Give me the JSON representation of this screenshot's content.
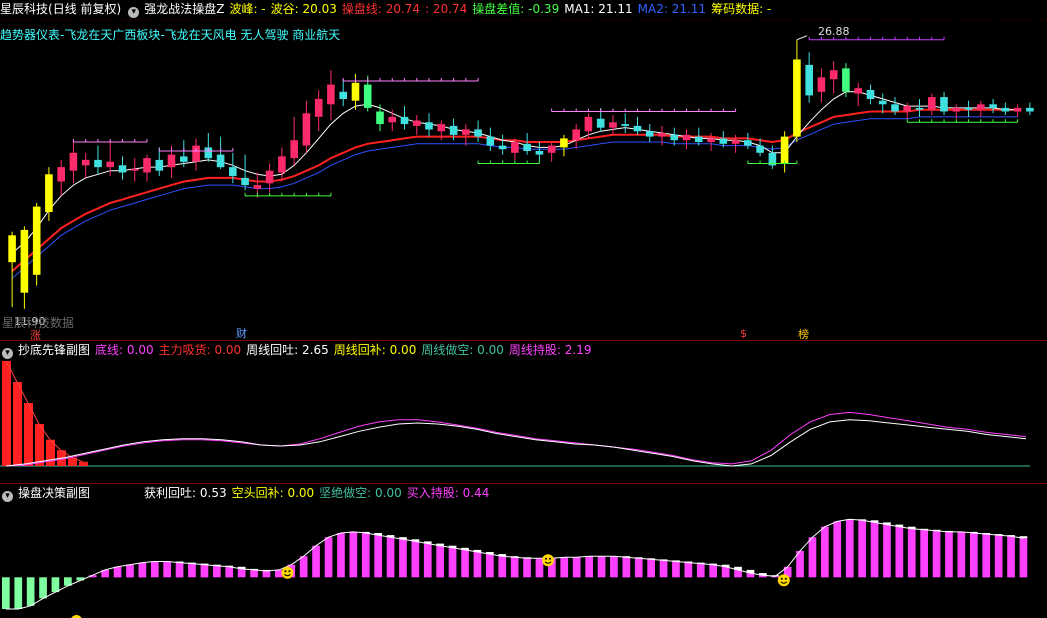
{
  "app": {
    "title": "星辰科技",
    "mode": "(日线 前复权)"
  },
  "main": {
    "indicator_name": "强龙战法操盘Z",
    "items": [
      {
        "label": "波峰:",
        "value": "-",
        "color": "#ffff00"
      },
      {
        "label": "波谷:",
        "value": "20.03",
        "color": "#ffff00"
      },
      {
        "label": "操盘线:",
        "value": "20.74",
        "color": "#ff3030"
      },
      {
        "label": ":",
        "value": "20.74",
        "color": "#ff3030"
      },
      {
        "label": "操盘差值:",
        "value": "-0.39",
        "color": "#40ff40"
      },
      {
        "label": "MA1:",
        "value": "21.11",
        "color": "#ffffff"
      },
      {
        "label": "MA2:",
        "value": "21.11",
        "color": "#3060ff"
      },
      {
        "label": "筹码数据:",
        "value": "-",
        "color": "#ffff00"
      }
    ],
    "second_line": "趋势器仪表-飞龙在天广西板块-飞龙在天风电 无人驾驶 商业航天",
    "high_price": "26.88",
    "low_price": "11.90",
    "watermark": "星辰科技数据",
    "markers": [
      {
        "text": "涨",
        "color": "#ff4040"
      },
      {
        "text": "财",
        "color": "#60a0ff"
      },
      {
        "text": "$",
        "color": "#ff4040"
      },
      {
        "text": "榜",
        "color": "#ffcc00"
      }
    ]
  },
  "sub1": {
    "name": "抄底先锋副图",
    "items": [
      {
        "label": "底线:",
        "value": "0.00",
        "color": "#ff40ff"
      },
      {
        "label": "主力吸货:",
        "value": "0.00",
        "color": "#ff3030"
      },
      {
        "label": "周线回吐:",
        "value": "2.65",
        "color": "#ffffff"
      },
      {
        "label": "周线回补:",
        "value": "0.00",
        "color": "#ffff00"
      },
      {
        "label": "周线做空:",
        "value": "0.00",
        "color": "#40c0a0"
      },
      {
        "label": "周线持股:",
        "value": "2.19",
        "color": "#ff40ff"
      }
    ]
  },
  "sub2": {
    "name": "操盘决策副图",
    "items": [
      {
        "label": "获利回吐:",
        "value": "0.53",
        "color": "#ffffff"
      },
      {
        "label": "空头回补:",
        "value": "0.00",
        "color": "#ffff00"
      },
      {
        "label": "坚绝做空:",
        "value": "0.00",
        "color": "#40c0a0"
      },
      {
        "label": "买入持股:",
        "value": "0.44",
        "color": "#ff40ff"
      }
    ]
  },
  "chart_data": [
    {
      "type": "candlestick",
      "title": "强龙战法操盘Z",
      "ylim": [
        11,
        28
      ],
      "candles": [
        {
          "o": 14.5,
          "h": 16.2,
          "l": 12.0,
          "c": 16.0
        },
        {
          "o": 12.8,
          "h": 16.5,
          "l": 11.9,
          "c": 16.3
        },
        {
          "o": 13.8,
          "h": 17.8,
          "l": 13.2,
          "c": 17.6
        },
        {
          "o": 17.3,
          "h": 19.8,
          "l": 16.8,
          "c": 19.4
        },
        {
          "o": 19.0,
          "h": 20.2,
          "l": 18.2,
          "c": 19.8
        },
        {
          "o": 19.6,
          "h": 21.2,
          "l": 18.9,
          "c": 20.6
        },
        {
          "o": 19.9,
          "h": 20.6,
          "l": 19.2,
          "c": 20.2
        },
        {
          "o": 20.2,
          "h": 21.0,
          "l": 19.4,
          "c": 19.8
        },
        {
          "o": 19.8,
          "h": 21.3,
          "l": 19.3,
          "c": 20.1
        },
        {
          "o": 19.9,
          "h": 20.4,
          "l": 19.1,
          "c": 19.5
        },
        {
          "o": 19.6,
          "h": 20.3,
          "l": 19.0,
          "c": 19.7
        },
        {
          "o": 19.5,
          "h": 20.5,
          "l": 19.0,
          "c": 20.3
        },
        {
          "o": 20.2,
          "h": 20.9,
          "l": 19.3,
          "c": 19.6
        },
        {
          "o": 19.8,
          "h": 21.0,
          "l": 19.2,
          "c": 20.5
        },
        {
          "o": 20.4,
          "h": 21.3,
          "l": 19.8,
          "c": 20.1
        },
        {
          "o": 20.1,
          "h": 21.4,
          "l": 19.6,
          "c": 21.0
        },
        {
          "o": 20.9,
          "h": 21.7,
          "l": 20.1,
          "c": 20.3
        },
        {
          "o": 20.5,
          "h": 21.5,
          "l": 19.7,
          "c": 19.8
        },
        {
          "o": 19.8,
          "h": 20.6,
          "l": 18.9,
          "c": 19.3
        },
        {
          "o": 19.2,
          "h": 20.5,
          "l": 18.5,
          "c": 18.8
        },
        {
          "o": 18.6,
          "h": 19.5,
          "l": 18.1,
          "c": 18.8
        },
        {
          "o": 18.9,
          "h": 20.0,
          "l": 18.4,
          "c": 19.6
        },
        {
          "o": 19.5,
          "h": 20.9,
          "l": 19.0,
          "c": 20.4
        },
        {
          "o": 20.3,
          "h": 22.6,
          "l": 19.9,
          "c": 21.3
        },
        {
          "o": 21.0,
          "h": 23.5,
          "l": 20.6,
          "c": 22.8
        },
        {
          "o": 22.6,
          "h": 24.1,
          "l": 21.8,
          "c": 23.6
        },
        {
          "o": 23.3,
          "h": 25.2,
          "l": 22.4,
          "c": 24.4
        },
        {
          "o": 24.0,
          "h": 24.7,
          "l": 23.2,
          "c": 23.6
        },
        {
          "o": 23.5,
          "h": 25.0,
          "l": 23.0,
          "c": 24.5
        },
        {
          "o": 24.4,
          "h": 24.9,
          "l": 22.9,
          "c": 23.1
        },
        {
          "o": 22.9,
          "h": 23.3,
          "l": 21.8,
          "c": 22.2
        },
        {
          "o": 22.3,
          "h": 23.0,
          "l": 21.8,
          "c": 22.6
        },
        {
          "o": 22.6,
          "h": 23.2,
          "l": 21.9,
          "c": 22.2
        },
        {
          "o": 22.1,
          "h": 22.7,
          "l": 21.6,
          "c": 22.4
        },
        {
          "o": 22.3,
          "h": 22.8,
          "l": 21.5,
          "c": 21.9
        },
        {
          "o": 21.8,
          "h": 22.4,
          "l": 21.3,
          "c": 22.2
        },
        {
          "o": 22.1,
          "h": 22.5,
          "l": 21.3,
          "c": 21.6
        },
        {
          "o": 21.6,
          "h": 22.2,
          "l": 21.0,
          "c": 21.9
        },
        {
          "o": 21.9,
          "h": 22.4,
          "l": 21.2,
          "c": 21.5
        },
        {
          "o": 21.5,
          "h": 22.0,
          "l": 20.7,
          "c": 21.0
        },
        {
          "o": 21.0,
          "h": 21.6,
          "l": 20.5,
          "c": 20.8
        },
        {
          "o": 20.6,
          "h": 21.4,
          "l": 20.2,
          "c": 21.2
        },
        {
          "o": 21.1,
          "h": 21.7,
          "l": 20.5,
          "c": 20.7
        },
        {
          "o": 20.7,
          "h": 21.2,
          "l": 20.1,
          "c": 20.5
        },
        {
          "o": 20.6,
          "h": 21.2,
          "l": 20.1,
          "c": 21.0
        },
        {
          "o": 20.9,
          "h": 21.6,
          "l": 20.4,
          "c": 21.4
        },
        {
          "o": 21.3,
          "h": 22.2,
          "l": 20.8,
          "c": 21.9
        },
        {
          "o": 21.8,
          "h": 22.8,
          "l": 21.4,
          "c": 22.6
        },
        {
          "o": 22.5,
          "h": 23.1,
          "l": 21.8,
          "c": 22.0
        },
        {
          "o": 22.0,
          "h": 22.7,
          "l": 21.6,
          "c": 22.3
        },
        {
          "o": 22.2,
          "h": 22.8,
          "l": 21.7,
          "c": 22.1
        },
        {
          "o": 22.1,
          "h": 22.6,
          "l": 21.6,
          "c": 21.8
        },
        {
          "o": 21.8,
          "h": 22.2,
          "l": 21.2,
          "c": 21.5
        },
        {
          "o": 21.5,
          "h": 22.1,
          "l": 21.0,
          "c": 21.7
        },
        {
          "o": 21.6,
          "h": 22.0,
          "l": 21.0,
          "c": 21.3
        },
        {
          "o": 21.3,
          "h": 21.9,
          "l": 20.8,
          "c": 21.6
        },
        {
          "o": 21.5,
          "h": 22.0,
          "l": 21.0,
          "c": 21.2
        },
        {
          "o": 21.2,
          "h": 21.7,
          "l": 20.7,
          "c": 21.4
        },
        {
          "o": 21.4,
          "h": 21.8,
          "l": 20.9,
          "c": 21.1
        },
        {
          "o": 21.1,
          "h": 21.6,
          "l": 20.6,
          "c": 21.3
        },
        {
          "o": 21.3,
          "h": 21.7,
          "l": 20.8,
          "c": 21.0
        },
        {
          "o": 21.0,
          "h": 21.4,
          "l": 20.4,
          "c": 20.6
        },
        {
          "o": 20.6,
          "h": 21.0,
          "l": 19.7,
          "c": 19.9
        },
        {
          "o": 20.0,
          "h": 21.8,
          "l": 19.5,
          "c": 21.5
        },
        {
          "o": 21.5,
          "h": 26.9,
          "l": 21.2,
          "c": 25.8
        },
        {
          "o": 25.5,
          "h": 26.2,
          "l": 23.4,
          "c": 23.8
        },
        {
          "o": 24.0,
          "h": 25.3,
          "l": 23.4,
          "c": 24.8
        },
        {
          "o": 24.7,
          "h": 25.7,
          "l": 23.9,
          "c": 25.2
        },
        {
          "o": 25.3,
          "h": 25.6,
          "l": 23.7,
          "c": 24.0
        },
        {
          "o": 23.9,
          "h": 24.5,
          "l": 23.2,
          "c": 24.2
        },
        {
          "o": 24.1,
          "h": 24.4,
          "l": 23.3,
          "c": 23.6
        },
        {
          "o": 23.5,
          "h": 23.9,
          "l": 22.8,
          "c": 23.3
        },
        {
          "o": 23.3,
          "h": 23.7,
          "l": 22.7,
          "c": 22.9
        },
        {
          "o": 22.9,
          "h": 23.4,
          "l": 22.5,
          "c": 23.2
        },
        {
          "o": 23.1,
          "h": 23.6,
          "l": 22.6,
          "c": 23.0
        },
        {
          "o": 23.0,
          "h": 23.9,
          "l": 22.7,
          "c": 23.7
        },
        {
          "o": 23.7,
          "h": 24.0,
          "l": 22.7,
          "c": 22.9
        },
        {
          "o": 22.9,
          "h": 23.3,
          "l": 22.5,
          "c": 23.1
        },
        {
          "o": 23.1,
          "h": 23.5,
          "l": 22.6,
          "c": 23.0
        },
        {
          "o": 23.0,
          "h": 23.5,
          "l": 22.6,
          "c": 23.3
        },
        {
          "o": 23.3,
          "h": 23.6,
          "l": 22.8,
          "c": 23.1
        },
        {
          "o": 23.1,
          "h": 23.4,
          "l": 22.7,
          "c": 22.9
        },
        {
          "o": 22.9,
          "h": 23.3,
          "l": 22.6,
          "c": 23.1
        },
        {
          "o": 23.1,
          "h": 23.4,
          "l": 22.7,
          "c": 22.9
        }
      ],
      "ma_red": [
        14,
        14.6,
        15.2,
        15.8,
        16.4,
        16.8,
        17.2,
        17.5,
        17.8,
        18.0,
        18.2,
        18.4,
        18.6,
        18.8,
        19.0,
        19.1,
        19.2,
        19.2,
        19.2,
        19.1,
        19.0,
        19.0,
        19.1,
        19.3,
        19.6,
        19.9,
        20.3,
        20.6,
        20.9,
        21.1,
        21.2,
        21.3,
        21.4,
        21.5,
        21.5,
        21.5,
        21.5,
        21.5,
        21.5,
        21.4,
        21.3,
        21.3,
        21.2,
        21.2,
        21.2,
        21.2,
        21.3,
        21.4,
        21.5,
        21.6,
        21.6,
        21.6,
        21.6,
        21.6,
        21.5,
        21.5,
        21.5,
        21.5,
        21.4,
        21.4,
        21.4,
        21.3,
        21.2,
        21.3,
        21.7,
        22.0,
        22.3,
        22.6,
        22.7,
        22.8,
        22.9,
        22.9,
        22.9,
        22.9,
        23.0,
        23.0,
        23.0,
        23.0,
        23.0,
        23.0,
        23.0,
        23.0,
        23.0
      ],
      "ma_white": [
        15,
        15.6,
        16.4,
        17.4,
        18.2,
        18.8,
        19.2,
        19.4,
        19.6,
        19.6,
        19.7,
        19.8,
        19.8,
        19.9,
        20.0,
        20.1,
        20.2,
        20.1,
        19.9,
        19.6,
        19.4,
        19.3,
        19.4,
        19.9,
        20.6,
        21.4,
        22.2,
        22.8,
        23.2,
        23.3,
        23.1,
        22.8,
        22.5,
        22.3,
        22.2,
        22.1,
        21.9,
        21.8,
        21.7,
        21.5,
        21.3,
        21.2,
        21.0,
        20.9,
        20.9,
        21.0,
        21.3,
        21.6,
        21.8,
        21.9,
        22.0,
        21.9,
        21.8,
        21.7,
        21.6,
        21.5,
        21.4,
        21.4,
        21.3,
        21.3,
        21.2,
        21.0,
        20.6,
        20.6,
        21.5,
        22.3,
        23.0,
        23.6,
        24.0,
        24.0,
        23.8,
        23.6,
        23.4,
        23.2,
        23.2,
        23.2,
        23.1,
        23.1,
        23.1,
        23.1,
        23.1,
        23.0,
        23.0
      ]
    },
    {
      "type": "bar",
      "title": "抄底先锋副图",
      "ylim": [
        0,
        10
      ],
      "red_bars": [
        10,
        8,
        6,
        4,
        2.5,
        1.5,
        0.8,
        0.4
      ],
      "white_line": [
        0,
        0.2,
        0.5,
        0.8,
        1.2,
        1.6,
        2.0,
        2.3,
        2.5,
        2.6,
        2.6,
        2.5,
        2.3,
        2.0,
        1.9,
        2.0,
        2.3,
        2.8,
        3.3,
        3.7,
        4.0,
        4.1,
        4.0,
        3.8,
        3.5,
        3.1,
        2.8,
        2.5,
        2.3,
        2.1,
        2.0,
        1.8,
        1.5,
        1.2,
        0.9,
        0.5,
        0.2,
        0.0,
        0.2,
        1.0,
        2.3,
        3.5,
        4.2,
        4.4,
        4.3,
        4.1,
        3.9,
        3.7,
        3.5,
        3.3,
        3.0,
        2.8,
        2.6
      ],
      "magenta_line": [
        0,
        0.1,
        0.4,
        0.7,
        1.1,
        1.5,
        1.9,
        2.2,
        2.4,
        2.5,
        2.5,
        2.4,
        2.2,
        2.0,
        1.9,
        2.1,
        2.6,
        3.2,
        3.8,
        4.2,
        4.4,
        4.4,
        4.2,
        3.9,
        3.6,
        3.2,
        2.9,
        2.6,
        2.4,
        2.2,
        2.0,
        1.8,
        1.6,
        1.3,
        1.0,
        0.6,
        0.3,
        0.2,
        0.5,
        1.5,
        3.0,
        4.2,
        4.9,
        5.1,
        4.9,
        4.6,
        4.3,
        4.0,
        3.7,
        3.5,
        3.2,
        3.0,
        2.8
      ]
    },
    {
      "type": "bar",
      "title": "操盘决策副图",
      "ylim": [
        -3,
        6
      ],
      "bars": [
        -3,
        -3,
        -2.7,
        -2,
        -1.4,
        -0.8,
        -0.3,
        0.2,
        0.7,
        1.0,
        1.2,
        1.4,
        1.5,
        1.5,
        1.4,
        1.3,
        1.2,
        1.1,
        1.0,
        0.8,
        0.7,
        0.6,
        0.7,
        1.2,
        2.0,
        3.0,
        3.8,
        4.2,
        4.3,
        4.2,
        4.0,
        3.8,
        3.6,
        3.4,
        3.2,
        3.0,
        2.8,
        2.6,
        2.4,
        2.2,
        2.0,
        1.9,
        1.8,
        1.8,
        1.8,
        1.9,
        1.9,
        2.0,
        2.0,
        2.0,
        1.9,
        1.8,
        1.7,
        1.6,
        1.5,
        1.4,
        1.3,
        1.2,
        1.0,
        0.7,
        0.4,
        0.2,
        0.1,
        1.0,
        2.5,
        3.8,
        4.8,
        5.3,
        5.5,
        5.4,
        5.2,
        5.0,
        4.8,
        4.6,
        4.5,
        4.4,
        4.3,
        4.3,
        4.2,
        4.1,
        4.0,
        3.9,
        3.7
      ],
      "smiley_count": 4
    }
  ]
}
